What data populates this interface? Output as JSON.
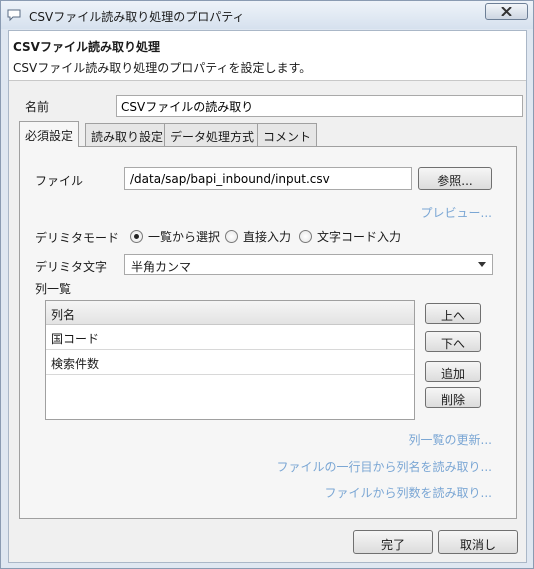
{
  "window": {
    "title": "CSVファイル読み取り処理のプロパティ",
    "icon": "speech-bubble-icon"
  },
  "header": {
    "title": "CSVファイル読み取り処理",
    "description": "CSVファイル読み取り処理のプロパティを設定します。"
  },
  "name_field": {
    "label": "名前",
    "value": "CSVファイルの読み取り"
  },
  "tabs": [
    {
      "label": "必須設定",
      "active": true
    },
    {
      "label": "読み取り設定",
      "active": false
    },
    {
      "label": "データ処理方式",
      "active": false
    },
    {
      "label": "コメント",
      "active": false
    }
  ],
  "required_tab": {
    "file_label": "ファイル",
    "file_value": "/data/sap/bapi_inbound/input.csv",
    "browse_label": "参照...",
    "preview_link": "プレビュー...",
    "delimiter_mode_label": "デリミタモード",
    "delimiter_mode_options": [
      {
        "label": "一覧から選択",
        "selected": true
      },
      {
        "label": "直接入力",
        "selected": false
      },
      {
        "label": "文字コード入力",
        "selected": false
      }
    ],
    "delimiter_char_label": "デリミタ文字",
    "delimiter_char_value": "半角カンマ",
    "column_list_label": "列一覧",
    "column_list_header": "列名",
    "column_list_rows": [
      "国コード",
      "検索件数"
    ],
    "buttons": {
      "up": "上へ",
      "down": "下へ",
      "add": "追加",
      "delete": "削除"
    },
    "links": {
      "refresh": "列一覧の更新...",
      "read_names": "ファイルの一行目から列名を読み取り...",
      "read_count": "ファイルから列数を読み取り..."
    }
  },
  "footer": {
    "ok_label": "完了",
    "cancel_label": "取消し"
  },
  "colors": {
    "link": "#7aa6d4",
    "background": "#f0f0f0"
  }
}
